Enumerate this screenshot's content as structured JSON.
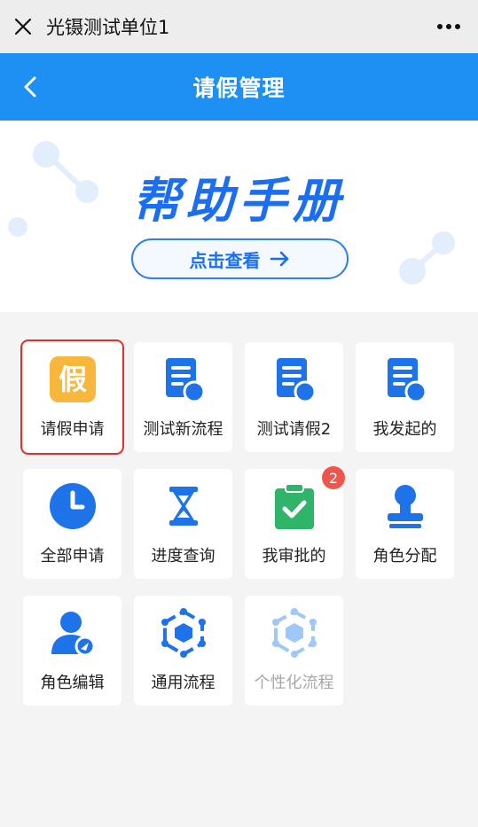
{
  "wechat_bar": {
    "title": "光镊测试单位1",
    "close_icon": "close-icon",
    "more_icon": "more-icon"
  },
  "app_bar": {
    "title": "请假管理",
    "back_icon": "back-arrow-icon",
    "color": "#1e90f4"
  },
  "banner": {
    "title": "帮助手册",
    "button_label": "点击查看",
    "button_icon": "arrow-right-icon",
    "accent": "#1b6ef0"
  },
  "tiles": [
    {
      "label": "请假申请",
      "icon": "leave-application-icon",
      "selected": true
    },
    {
      "label": "测试新流程",
      "icon": "document-icon"
    },
    {
      "label": "测试请假2",
      "icon": "document-icon"
    },
    {
      "label": "我发起的",
      "icon": "document-icon"
    },
    {
      "label": "全部申请",
      "icon": "clock-icon"
    },
    {
      "label": "进度查询",
      "icon": "hourglass-icon"
    },
    {
      "label": "我审批的",
      "icon": "clipboard-check-icon",
      "badge": "2"
    },
    {
      "label": "角色分配",
      "icon": "stamp-icon"
    },
    {
      "label": "角色编辑",
      "icon": "user-edit-icon"
    },
    {
      "label": "通用流程",
      "icon": "hexagon-network-icon"
    },
    {
      "label": "个性化流程",
      "icon": "hexagon-network-icon",
      "disabled": true
    }
  ],
  "leave_icon_glyph": "假",
  "colors": {
    "primary": "#1e90f4",
    "tile_blue": "#1e73e8",
    "leave_orange": "#f6b73c",
    "approve_green": "#2fb56a",
    "badge_red": "#f0554c",
    "selected_outline": "#e03131"
  }
}
